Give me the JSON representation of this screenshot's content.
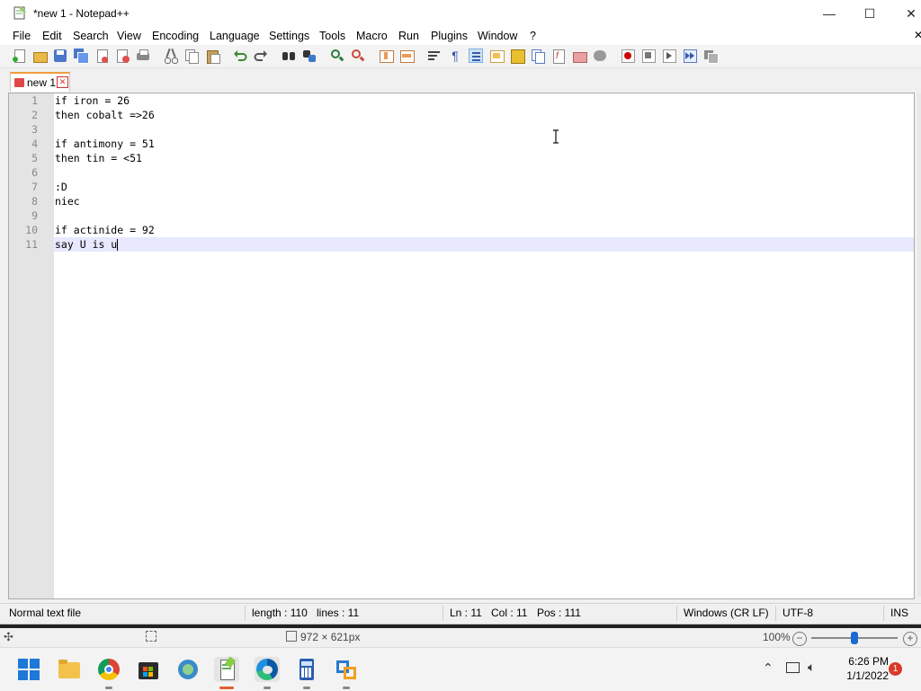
{
  "window": {
    "title": "*new 1 - Notepad++",
    "minimize_symbol": "—",
    "maximize_symbol": "☐",
    "close_symbol": "✕"
  },
  "menu": {
    "items": [
      "File",
      "Edit",
      "Search",
      "View",
      "Encoding",
      "Language",
      "Settings",
      "Tools",
      "Macro",
      "Run",
      "Plugins",
      "Window",
      "?"
    ],
    "close_symbol": "✕"
  },
  "toolbar": {
    "icons": [
      "new-file-icon",
      "open-file-icon",
      "save-icon",
      "save-all-icon",
      "close-icon",
      "close-all-icon",
      "print-icon",
      "cut-icon",
      "copy-icon",
      "paste-icon",
      "undo-icon",
      "redo-icon",
      "find-icon",
      "replace-icon",
      "zoom-in-icon",
      "zoom-out-icon",
      "sync-vertical-icon",
      "sync-horizontal-icon",
      "word-wrap-icon",
      "show-all-chars-icon",
      "indent-guide-icon",
      "user-language-icon",
      "document-map-icon",
      "document-list-icon",
      "function-list-icon",
      "folder-workspace-icon",
      "monitoring-icon",
      "record-macro-icon",
      "stop-record-icon",
      "playback-macro-icon",
      "run-macro-multiple-icon",
      "save-macro-icon"
    ],
    "record_color": "#cc0000"
  },
  "tabs": [
    {
      "label": "new 1",
      "close_symbol": "✕",
      "accent": "#f39b3d"
    }
  ],
  "editor": {
    "lines": [
      {
        "num": "1",
        "text": "if iron = 26"
      },
      {
        "num": "2",
        "text": "then cobalt =>26"
      },
      {
        "num": "3",
        "text": ""
      },
      {
        "num": "4",
        "text": "if antimony = 51"
      },
      {
        "num": "5",
        "text": "then tin = <51"
      },
      {
        "num": "6",
        "text": ""
      },
      {
        "num": "7",
        "text": ":D"
      },
      {
        "num": "8",
        "text": "niec"
      },
      {
        "num": "9",
        "text": ""
      },
      {
        "num": "10",
        "text": "if actinide = 92"
      },
      {
        "num": "11",
        "text": "say U is u"
      }
    ],
    "current_line": 11,
    "current_line_color": "#e8e8ff"
  },
  "status": {
    "file_type": "Normal text file",
    "length": "length : 110",
    "lines": "lines : 11",
    "ln": "Ln : 11",
    "col": "Col : 11",
    "pos": "Pos : 111",
    "eol": "Windows (CR LF)",
    "encoding": "UTF-8",
    "mode": "INS"
  },
  "viewer": {
    "dimensions": "972 × 621px",
    "zoom": "100%",
    "zoom_slider_fraction": 0.5
  },
  "taskbar": {
    "apps": [
      "start-icon",
      "file-explorer-icon",
      "chrome-icon",
      "store-icon",
      "app-icon",
      "notepadpp-icon",
      "edge-icon",
      "calculator-icon",
      "remote-icon"
    ],
    "time": "6:26 PM",
    "date": "1/1/2022",
    "notification_count": "1"
  }
}
